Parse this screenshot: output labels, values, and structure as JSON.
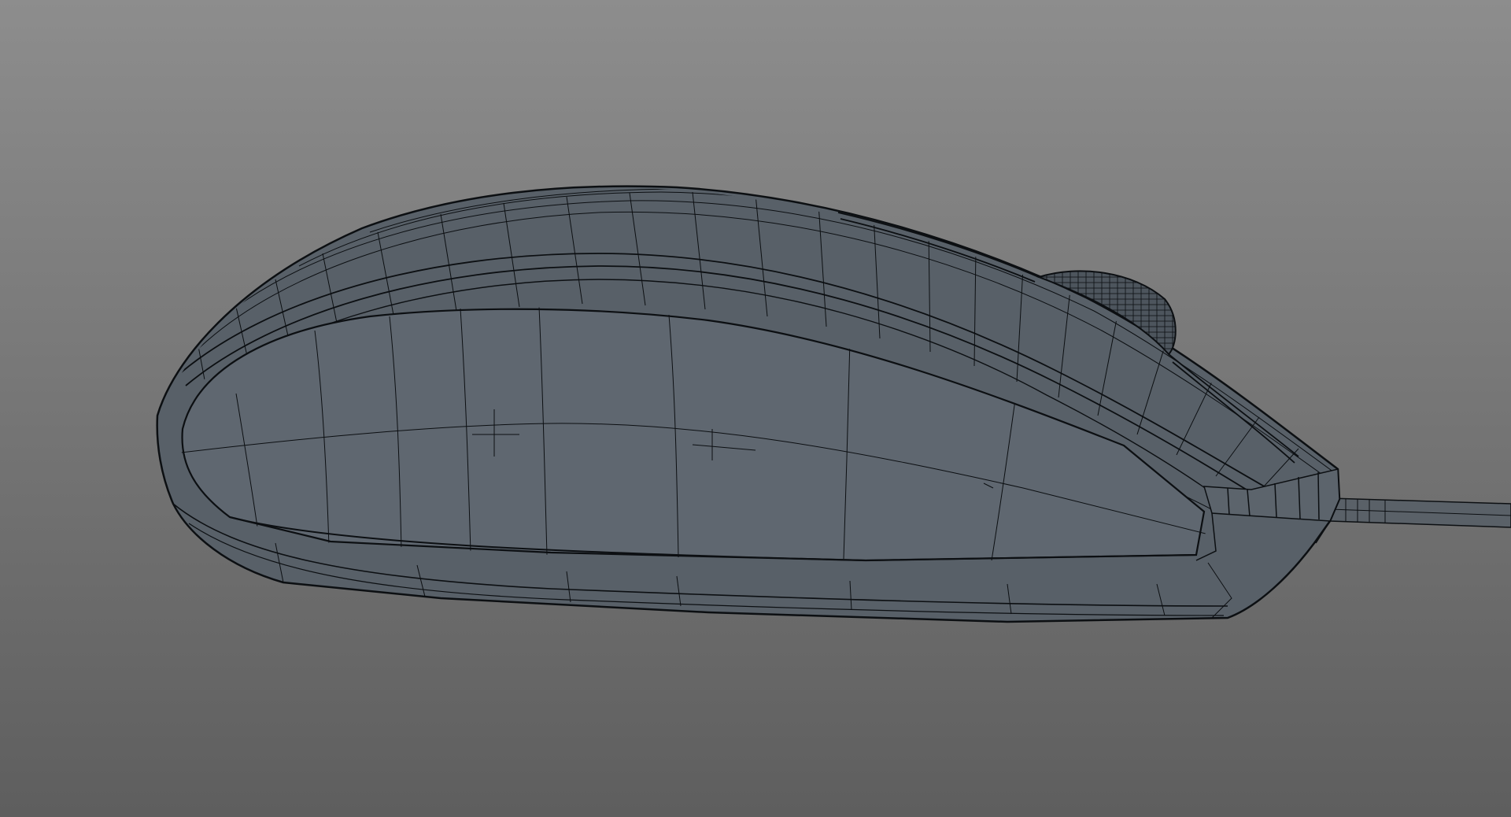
{
  "viewport": {
    "background_top_color": "#8d8d8d",
    "background_bottom_color": "#5e5e5e",
    "shading_mode": "wireframe-on-shaded"
  },
  "model": {
    "object": "computer-mouse",
    "surface_color": "#586068",
    "surface_side_color": "#5f6770",
    "wire_color": "#0c0f12",
    "parts": [
      "mouse-shell",
      "mouse-side-panel",
      "scroll-wheel",
      "mouse-cable"
    ]
  }
}
